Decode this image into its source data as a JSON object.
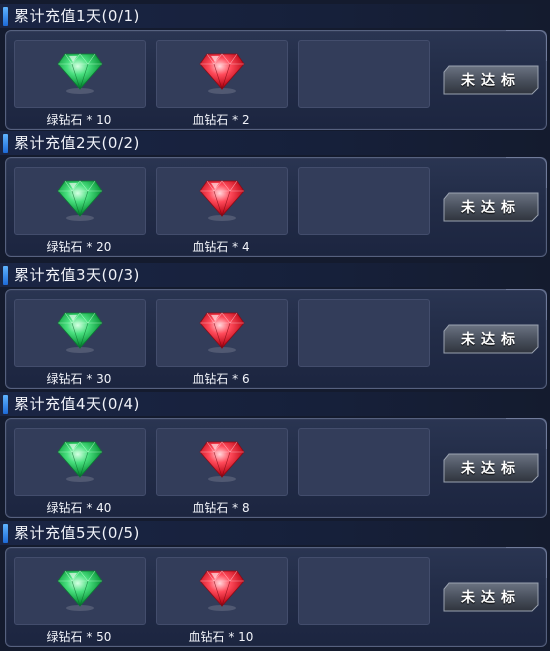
{
  "colors": {
    "background": "#141b2e",
    "card": "#232d48",
    "slot": "#333d5a",
    "accent": "#3d8fef",
    "green_gem": "#2fd36a",
    "red_gem": "#ef3144"
  },
  "rows": [
    {
      "title": "累计充值1天(0/1)",
      "rewards": [
        {
          "icon": "green-diamond-icon",
          "label": "绿钻石 * 10"
        },
        {
          "icon": "red-diamond-icon",
          "label": "血钻石 * 2"
        }
      ],
      "status": "未达标"
    },
    {
      "title": "累计充值2天(0/2)",
      "rewards": [
        {
          "icon": "green-diamond-icon",
          "label": "绿钻石 * 20"
        },
        {
          "icon": "red-diamond-icon",
          "label": "血钻石 * 4"
        }
      ],
      "status": "未达标"
    },
    {
      "title": "累计充值3天(0/3)",
      "rewards": [
        {
          "icon": "green-diamond-icon",
          "label": "绿钻石 * 30"
        },
        {
          "icon": "red-diamond-icon",
          "label": "血钻石 * 6"
        }
      ],
      "status": "未达标"
    },
    {
      "title": "累计充值4天(0/4)",
      "rewards": [
        {
          "icon": "green-diamond-icon",
          "label": "绿钻石 * 40"
        },
        {
          "icon": "red-diamond-icon",
          "label": "血钻石 * 8"
        }
      ],
      "status": "未达标"
    },
    {
      "title": "累计充值5天(0/5)",
      "rewards": [
        {
          "icon": "green-diamond-icon",
          "label": "绿钻石 * 50"
        },
        {
          "icon": "red-diamond-icon",
          "label": "血钻石 * 10"
        }
      ],
      "status": "未达标"
    }
  ]
}
